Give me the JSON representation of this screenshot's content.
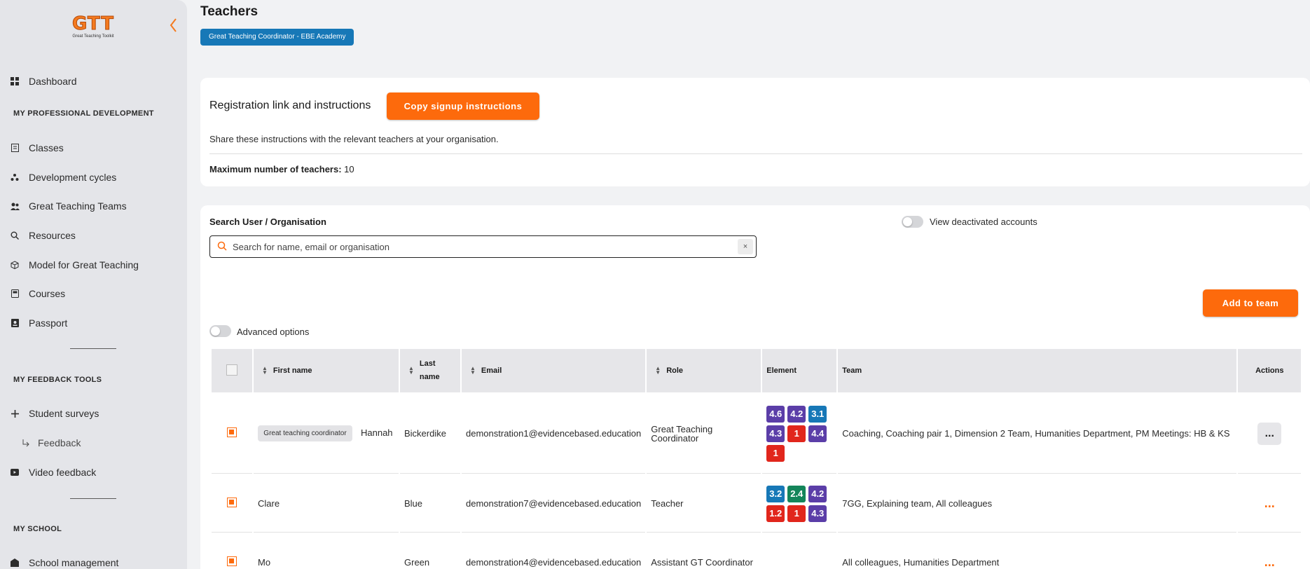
{
  "logo": {
    "mark": "GTT",
    "sub": "Great Teaching Toolkit"
  },
  "sidebar": {
    "dashboard": "Dashboard",
    "section_pd": "MY PROFESSIONAL DEVELOPMENT",
    "pd_items": [
      "Classes",
      "Development cycles",
      "Great Teaching Teams",
      "Resources",
      "Model for Great Teaching",
      "Courses",
      "Passport"
    ],
    "section_feedback": "MY FEEDBACK TOOLS",
    "feedback_items": [
      "Student surveys",
      "Feedback",
      "Video feedback"
    ],
    "section_school": "MY SCHOOL",
    "school_items": [
      "School management"
    ]
  },
  "page": {
    "title": "Teachers",
    "role_badge": "Great Teaching Coordinator - EBE Academy"
  },
  "registration": {
    "title": "Registration link and instructions",
    "copy_button": "Copy signup instructions",
    "share_text": "Share these instructions with the relevant teachers at your organisation.",
    "max_label": "Maximum number of teachers:",
    "max_value": "10"
  },
  "search": {
    "label": "Search User / Organisation",
    "placeholder": "Search for name, email or organisation",
    "clear": "×",
    "deactivated_label": "View deactivated accounts",
    "advanced_label": "Advanced options",
    "add_team_button": "Add to team"
  },
  "table": {
    "headers": {
      "first_name": "First name",
      "last_name_1": "Last",
      "last_name_2": "name",
      "email": "Email",
      "role": "Role",
      "element": "Element",
      "team": "Team",
      "actions": "Actions"
    },
    "rows": [
      {
        "chip": "Great teaching coordinator",
        "first_name": "Hannah",
        "last_name": "Bickerdike",
        "email": "demonstration1@evidencebased.education",
        "role": "Great Teaching Coordinator",
        "elements": [
          {
            "label": "4.6",
            "color": "#5b3ea8"
          },
          {
            "label": "4.2",
            "color": "#5b3ea8"
          },
          {
            "label": "3.1",
            "color": "#1778b7"
          },
          {
            "label": "4.3",
            "color": "#5b3ea8"
          },
          {
            "label": "1",
            "color": "#e1261c"
          },
          {
            "label": "4.4",
            "color": "#5b3ea8"
          },
          {
            "label": "1",
            "color": "#e1261c"
          }
        ],
        "team": "Coaching, Coaching pair 1, Dimension 2 Team, Humanities Department, PM Meetings: HB & KS",
        "actions": "..."
      },
      {
        "chip": "",
        "first_name": "Clare",
        "last_name": "Blue",
        "email": "demonstration7@evidencebased.education",
        "role": "Teacher",
        "elements": [
          {
            "label": "3.2",
            "color": "#1778b7"
          },
          {
            "label": "2.4",
            "color": "#14855a"
          },
          {
            "label": "4.2",
            "color": "#5b3ea8"
          },
          {
            "label": "1.2",
            "color": "#e1261c"
          },
          {
            "label": "1",
            "color": "#e1261c"
          },
          {
            "label": "4.3",
            "color": "#5b3ea8"
          }
        ],
        "team": "7GG, Explaining team, All colleagues",
        "actions": "..."
      },
      {
        "chip": "",
        "first_name": "Mo",
        "last_name": "Green",
        "email": "demonstration4@evidencebased.education",
        "role": "Assistant GT Coordinator",
        "elements": [],
        "team": "All colleagues, Humanities Department",
        "actions": "..."
      }
    ]
  },
  "colors": {
    "accent": "#fd6a0c",
    "badge": "#1778b7",
    "sidebar_bg": "#e4e5e9",
    "page_bg": "#f1f2f4"
  }
}
